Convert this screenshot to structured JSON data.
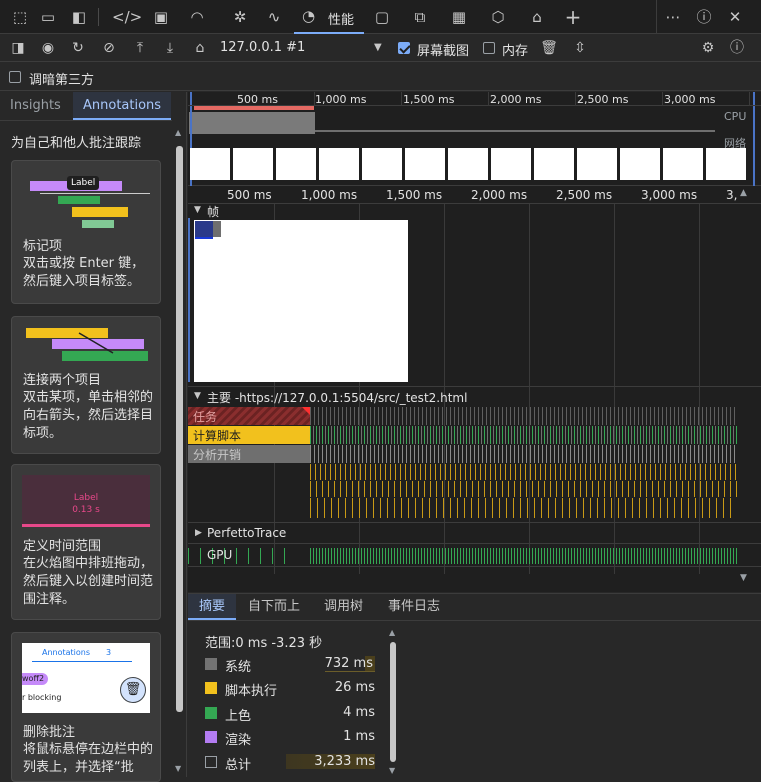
{
  "tabs": {
    "performance_label": "性能"
  },
  "toolbar": {
    "url": "127.0.0.1 #1",
    "screenshot_label": "屏幕截图",
    "screenshot_checked": true,
    "memory_label": "内存",
    "memory_checked": false
  },
  "options": {
    "dim_third_party_label": "调暗第三方"
  },
  "sidebar": {
    "tab_insights": "Insights",
    "tab_annotations": "Annotations",
    "intro": "为自己和他人批注跟踪",
    "cards": [
      {
        "title": "标记项",
        "desc": "双击或按 Enter 键，然后键入项目标签。",
        "preview_label": "Label"
      },
      {
        "title": "连接两个项目",
        "desc": "双击某项，单击相邻的向右箭头，然后选择目标项。"
      },
      {
        "title": "定义时间范围",
        "desc": "在火焰图中排班拖动，然后键入以创建时间范围注释。",
        "preview_label": "Label",
        "preview_time": "0.13 s"
      },
      {
        "title": "删除批注",
        "desc": "将鼠标悬停在边栏中的列表上，并选择“批",
        "preview_header": "Annotations",
        "preview_count": "3",
        "preview_chip": "woff2",
        "preview_text": "r blocking"
      }
    ]
  },
  "overview": {
    "ticks": [
      "500 ms",
      "1,000 ms",
      "1,500 ms",
      "2,000 ms",
      "2,500 ms",
      "3,000 ms"
    ],
    "cpu_label": "CPU",
    "network_label": "网络"
  },
  "ruler": {
    "ticks": [
      "500 ms",
      "1,000 ms",
      "1,500 ms",
      "2,000 ms",
      "2,500 ms",
      "3,000 ms",
      "3,"
    ]
  },
  "tracks": {
    "frames_label": "帧",
    "main_label": "主要 -https://127.0.0.1:5504/src/_test2.html",
    "legend": [
      "任务",
      "计算脚本",
      "分析开销"
    ],
    "perfetto_label": "PerfettoTrace",
    "gpu_label": "GPU"
  },
  "bottom": {
    "tabs": [
      "摘要",
      "自下而上",
      "调用树",
      "事件日志"
    ],
    "range": "范围:0 ms -3.23 秒",
    "rows": [
      {
        "name": "系统",
        "value": "732 ms",
        "color": "#737373"
      },
      {
        "name": "脚本执行",
        "value": "26 ms",
        "color": "#f2c11d"
      },
      {
        "name": "上色",
        "value": "4 ms",
        "color": "#34a853"
      },
      {
        "name": "渲染",
        "value": "1 ms",
        "color": "#b37cf2"
      },
      {
        "name": "总计",
        "value": "3,233 ms",
        "color": "transparent"
      }
    ]
  }
}
